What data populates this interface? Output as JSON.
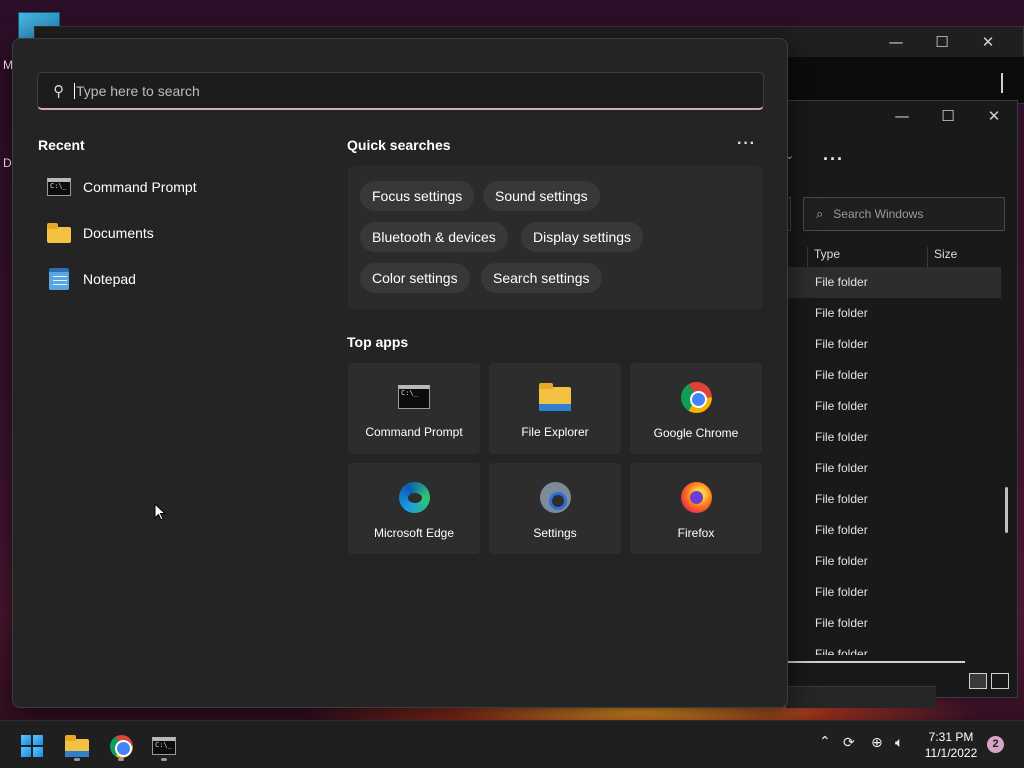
{
  "desktop": {
    "labels": [
      "M",
      "Da"
    ]
  },
  "explorer": {
    "search_placeholder": "Search Windows",
    "columns": [
      "Type",
      "Size"
    ],
    "rows": [
      "File folder",
      "File folder",
      "File folder",
      "File folder",
      "File folder",
      "File folder",
      "File folder",
      "File folder",
      "File folder",
      "File folder",
      "File folder",
      "File folder",
      "File folder"
    ]
  },
  "start_menu": {
    "search": {
      "placeholder": "Type here to search",
      "value": ""
    },
    "recent": {
      "title": "Recent",
      "items": [
        {
          "label": "Command Prompt",
          "icon": "command-prompt-icon"
        },
        {
          "label": "Documents",
          "icon": "folder-icon"
        },
        {
          "label": "Notepad",
          "icon": "notepad-icon"
        }
      ]
    },
    "quick_searches": {
      "title": "Quick searches",
      "more": "···",
      "chips": [
        "Focus settings",
        "Sound settings",
        "Bluetooth & devices",
        "Display settings",
        "Color settings",
        "Search settings"
      ]
    },
    "top_apps": {
      "title": "Top apps",
      "apps": [
        {
          "label": "Command Prompt",
          "icon": "command-prompt-icon"
        },
        {
          "label": "File Explorer",
          "icon": "file-explorer-icon"
        },
        {
          "label": "Google Chrome",
          "icon": "chrome-icon"
        },
        {
          "label": "Microsoft Edge",
          "icon": "edge-icon"
        },
        {
          "label": "Settings",
          "icon": "settings-gear-icon"
        },
        {
          "label": "Firefox",
          "icon": "firefox-icon"
        }
      ]
    }
  },
  "taskbar": {
    "apps": [
      "start-icon",
      "file-explorer-icon",
      "chrome-icon",
      "command-prompt-icon"
    ],
    "tray_icons": [
      "chevron-up-icon",
      "sync-icon",
      "network-icon",
      "volume-icon"
    ],
    "time": "7:31 PM",
    "date": "11/1/2022",
    "notification_count": "2"
  },
  "colors": {
    "accent": "#d6a6c2",
    "menu_bg": "#242424",
    "taskbar_bg": "#1f1f1f"
  }
}
